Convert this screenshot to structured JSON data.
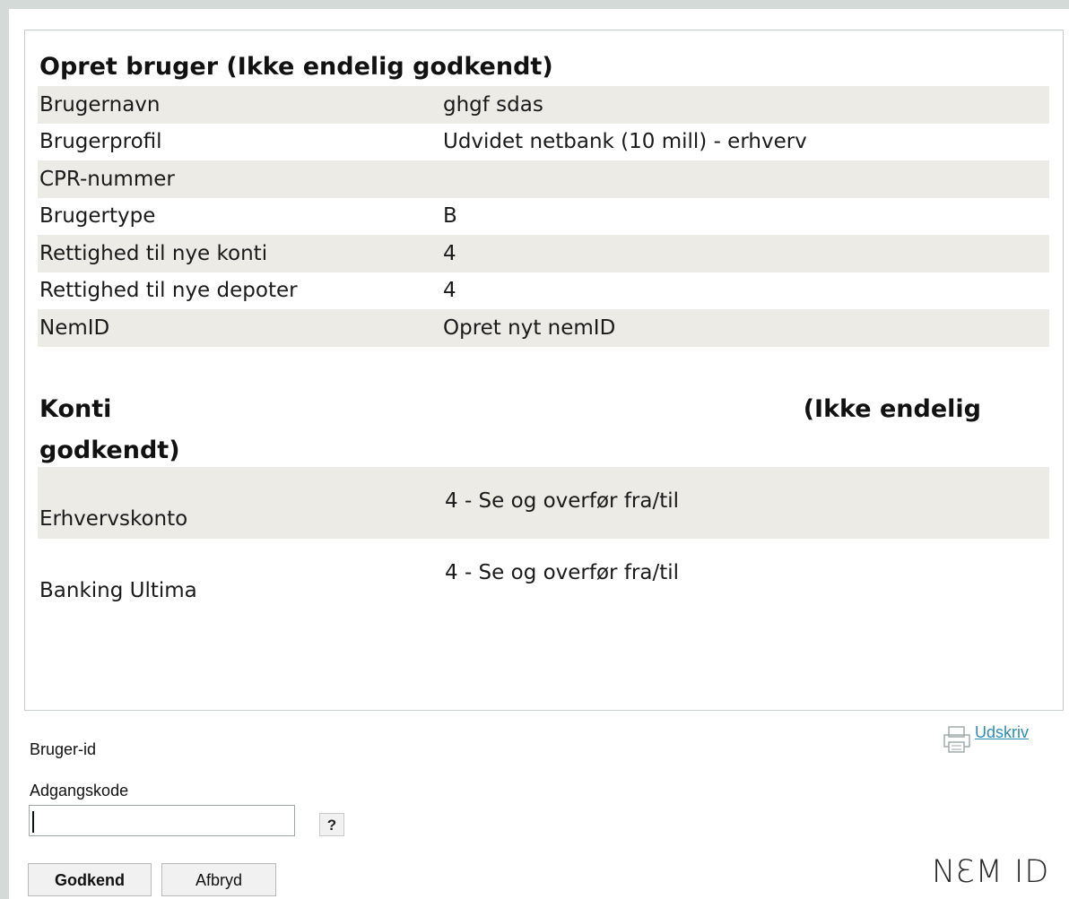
{
  "summary": {
    "title": "Opret bruger (Ikke endelig godkendt)",
    "rows": [
      {
        "label": "Brugernavn",
        "value": "ghgf sdas"
      },
      {
        "label": "Brugerprofil",
        "value": "Udvidet netbank (10 mill) - erhverv"
      },
      {
        "label": "CPR-nummer",
        "value": ""
      },
      {
        "label": "Brugertype",
        "value": "B"
      },
      {
        "label": "Rettighed til nye konti",
        "value": "4"
      },
      {
        "label": "Rettighed til nye depoter",
        "value": "4"
      },
      {
        "label": "NemID",
        "value": "Opret nyt nemID"
      }
    ]
  },
  "accounts": {
    "title_left": "Konti",
    "title_right": "(Ikke endelig",
    "title_line2": "godkendt)",
    "items": [
      {
        "name": "Erhvervskonto",
        "permission": "4 - Se og overfør fra/til"
      },
      {
        "name": "Banking Ultima",
        "permission": "4 - Se og overfør fra/til"
      }
    ]
  },
  "login": {
    "userid_label": "Bruger-id",
    "password_label": "Adgangskode",
    "password_value": "",
    "help_label": "?",
    "approve_label": "Godkend",
    "cancel_label": "Afbryd"
  },
  "print": {
    "label": "Udskriv",
    "icon": "printer-icon"
  },
  "logo": {
    "text": "NEM ID"
  },
  "colors": {
    "shaded_row": "#ecebe5",
    "link": "#2a8fb8",
    "frame": "#d3dad8"
  }
}
